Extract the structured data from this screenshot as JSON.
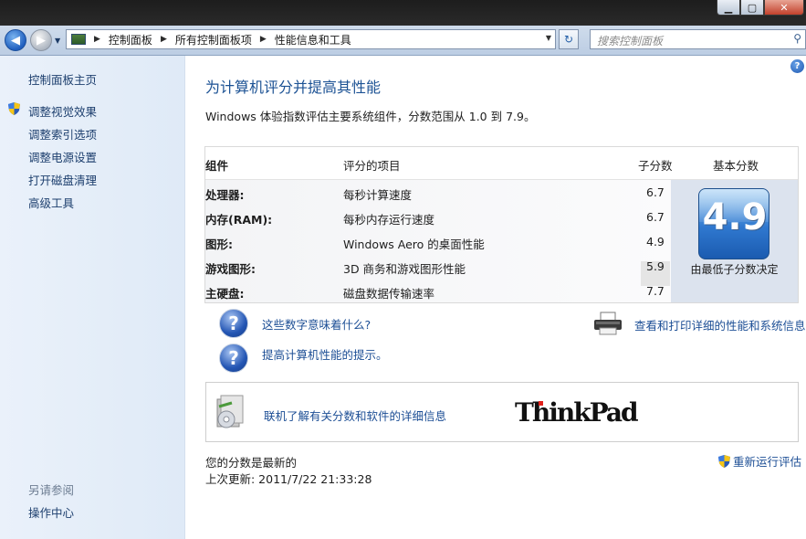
{
  "window": {
    "min_label": "▁",
    "max_label": "▢",
    "close_label": "✕"
  },
  "nav": {
    "back_label": "◀",
    "forward_label": "▶",
    "breadcrumb": [
      "控制面板",
      "所有控制面板项",
      "性能信息和工具"
    ],
    "refresh_label": "↻",
    "search_placeholder": "搜索控制面板"
  },
  "sidebar": {
    "home": "控制面板主页",
    "links": [
      "调整视觉效果",
      "调整索引选项",
      "调整电源设置",
      "打开磁盘清理",
      "高级工具"
    ],
    "see_also": "另请参阅",
    "see_also_links": [
      "操作中心"
    ]
  },
  "main": {
    "help_label": "?",
    "title": "为计算机评分并提高其性能",
    "description": "Windows 体验指数评估主要系统组件，分数范围从 1.0 到 7.9。",
    "table": {
      "headers": {
        "component": "组件",
        "rated_item": "评分的项目",
        "subscore": "子分数",
        "base_score": "基本分数"
      },
      "rows": [
        {
          "component": "处理器:",
          "item": "每秒计算速度",
          "score": "6.7"
        },
        {
          "component": "内存(RAM):",
          "item": "每秒内存运行速度",
          "score": "6.7"
        },
        {
          "component": "图形:",
          "item": "Windows Aero 的桌面性能",
          "score": "4.9"
        },
        {
          "component": "游戏图形:",
          "item": "3D 商务和游戏图形性能",
          "score": "5.9"
        },
        {
          "component": "主硬盘:",
          "item": "磁盘数据传输速率",
          "score": "7.7"
        }
      ],
      "base_score": "4.9",
      "base_note": "由最低子分数决定"
    },
    "links": {
      "what_numbers": "这些数字意味着什么?",
      "tips": "提高计算机性能的提示。",
      "print_details": "查看和打印详细的性能和系统信息",
      "online_info": "联机了解有关分数和软件的详细信息"
    },
    "brand_logo": "ThinkPad",
    "status": {
      "current": "您的分数是最新的",
      "last_update": "上次更新: 2011/7/22 21:33:28",
      "rerun": "重新运行评估"
    }
  },
  "colors": {
    "accent": "#1c5294",
    "link": "#1c4e95",
    "sidebar_bg": "#e3ecf8"
  }
}
